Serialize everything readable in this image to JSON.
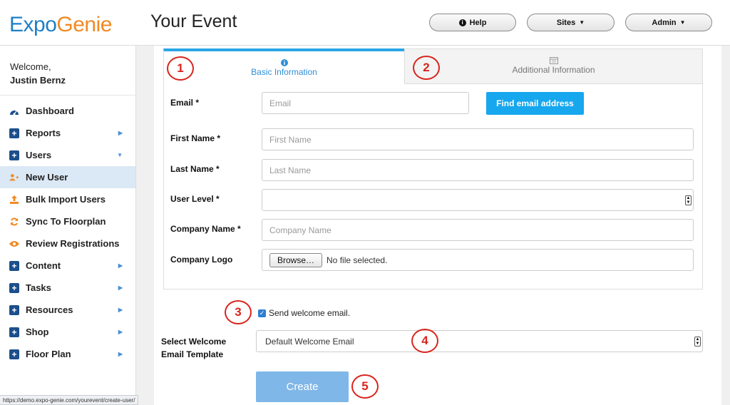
{
  "header": {
    "logo_part1": "Expo",
    "logo_part2": "Genie",
    "page_title": "Your Event",
    "help_label": "Help",
    "sites_label": "Sites",
    "admin_label": "Admin"
  },
  "sidebar": {
    "welcome": "Welcome,",
    "user_name": "Justin Bernz",
    "items": [
      {
        "label": "Dashboard",
        "icon": "dashboard-icon"
      },
      {
        "label": "Reports",
        "icon": "plus-square-icon",
        "arrow": "right"
      },
      {
        "label": "Users",
        "icon": "plus-square-icon",
        "arrow": "down"
      },
      {
        "label": "New User",
        "icon": "user-plus-icon",
        "active": true
      },
      {
        "label": "Bulk Import Users",
        "icon": "upload-icon"
      },
      {
        "label": "Sync To Floorplan",
        "icon": "sync-icon"
      },
      {
        "label": "Review Registrations",
        "icon": "eye-icon"
      },
      {
        "label": "Content",
        "icon": "plus-square-icon",
        "arrow": "right"
      },
      {
        "label": "Tasks",
        "icon": "plus-square-icon",
        "arrow": "right"
      },
      {
        "label": "Resources",
        "icon": "plus-square-icon",
        "arrow": "right"
      },
      {
        "label": "Shop",
        "icon": "plus-square-icon",
        "arrow": "right"
      },
      {
        "label": "Floor Plan",
        "icon": "plus-square-icon",
        "arrow": "right"
      }
    ]
  },
  "tabs": {
    "basic": "Basic Information",
    "additional": "Additional Information"
  },
  "form": {
    "email_label": "Email *",
    "email_placeholder": "Email",
    "find_email_button": "Find email address",
    "first_name_label": "First Name *",
    "first_name_placeholder": "First Name",
    "last_name_label": "Last Name *",
    "last_name_placeholder": "Last Name",
    "user_level_label": "User Level *",
    "company_name_label": "Company Name *",
    "company_name_placeholder": "Company Name",
    "company_logo_label": "Company Logo",
    "browse_button": "Browse…",
    "no_file": "No file selected.",
    "send_welcome": "Send welcome email.",
    "template_label": "Select Welcome Email Template",
    "template_value": "Default Welcome Email",
    "create_button": "Create"
  },
  "markers": [
    "1",
    "2",
    "3",
    "4",
    "5"
  ],
  "status_url": "https://demo.expo-genie.com/yourevent/create-user/",
  "colors": {
    "brand_blue": "#1f7fc6",
    "brand_orange": "#f08a24",
    "accent": "#16a7ee",
    "marker_red": "#d9241c"
  }
}
